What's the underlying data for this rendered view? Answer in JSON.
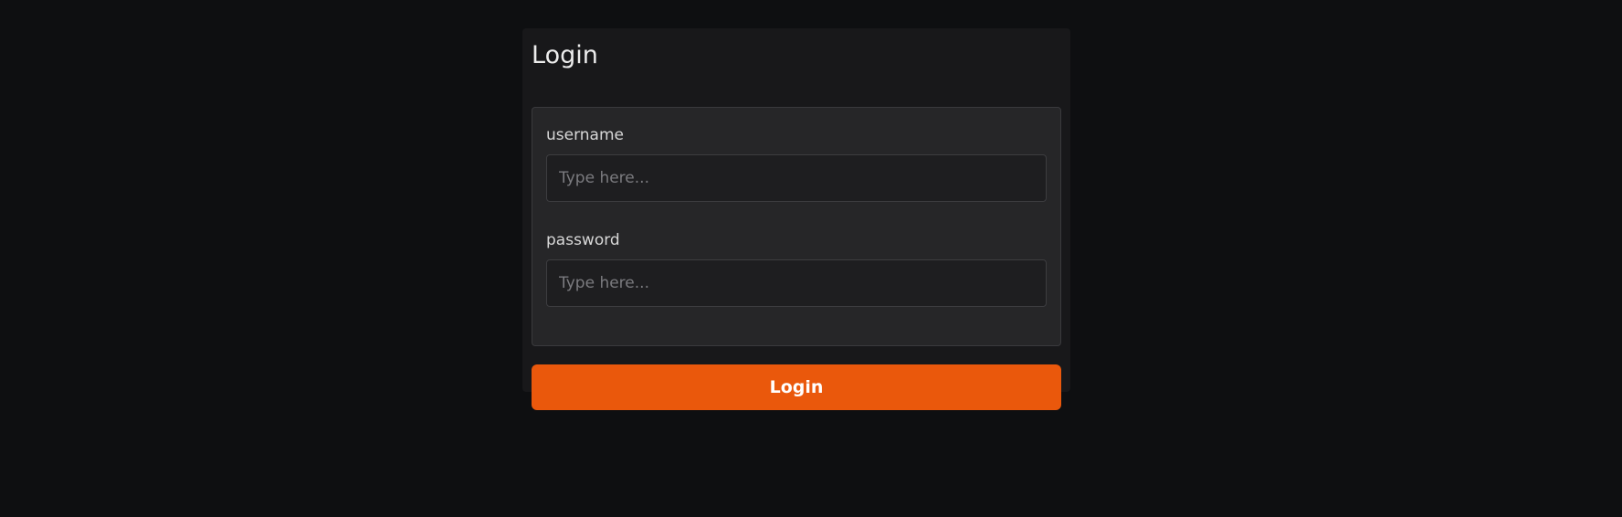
{
  "login_form": {
    "title": "Login",
    "fields": {
      "username": {
        "label": "username",
        "placeholder": "Type here...",
        "value": ""
      },
      "password": {
        "label": "password",
        "placeholder": "Type here...",
        "value": ""
      }
    },
    "submit_label": "Login"
  },
  "colors": {
    "background": "#0e0f11",
    "card": "#18181a",
    "fieldset": "#262628",
    "accent": "#ea580c"
  }
}
